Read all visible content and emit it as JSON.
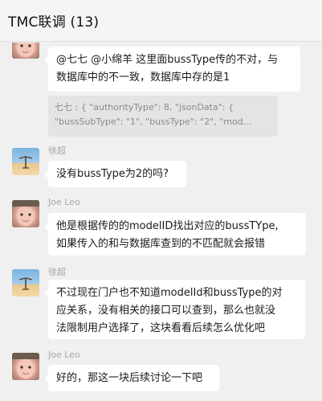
{
  "header": {
    "title": "TMC联调 (13)"
  },
  "messages": [
    {
      "avatar": "baby-avatar",
      "lines": [
        "@七七 @小绵羊 这里面bussType传的不对，与",
        "数据库中的不一致，数据库中存的是1"
      ],
      "quote": [
        "七七 : { \"authorityType\": 8, \"jsonData\": {",
        "\"bussSubType\": \"1\", \"bussType\": \"2\", \"mod..."
      ]
    },
    {
      "sender": "徐超",
      "avatar": "sky-avatar",
      "lines": [
        "没有bussType为2的吗?"
      ]
    },
    {
      "sender": "Joe Leo",
      "avatar": "baby-avatar",
      "lines": [
        "他是根据传的的modelID找出对应的bussTYpe,",
        "如果传入的和与数据库查到的不匹配就会报错"
      ]
    },
    {
      "sender": "徐超",
      "avatar": "sky-avatar",
      "lines": [
        "不过现在门户也不知道modelId和bussType的对",
        "应关系，没有相关的接口可以查到，那么也就没",
        "法限制用户选择了，这块看看后续怎么优化吧"
      ]
    },
    {
      "sender": "Joe Leo",
      "avatar": "baby-avatar",
      "lines": [
        "好的，那这一块后续讨论一下吧"
      ]
    }
  ]
}
